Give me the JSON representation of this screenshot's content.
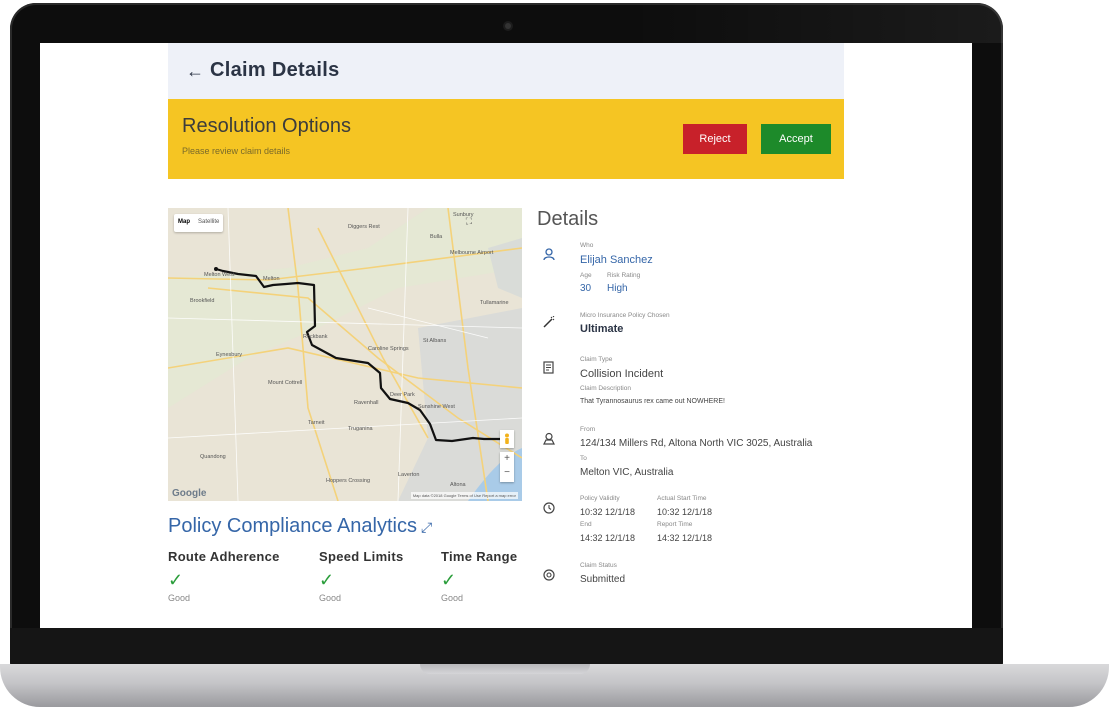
{
  "header": {
    "back_icon": "arrow-left-icon",
    "title": "Claim Details"
  },
  "banner": {
    "title": "Resolution Options",
    "subtitle": "Please review claim details",
    "reject_label": "Reject",
    "accept_label": "Accept",
    "colors": {
      "banner": "#f5c523",
      "reject": "#c8212a",
      "accept": "#1d8a2a"
    }
  },
  "map": {
    "toggle": [
      "Map",
      "Satellite"
    ],
    "places": [
      "Diggers Rest",
      "Bulla",
      "Sunbury",
      "Melbourne Airport",
      "Melton West",
      "Melton",
      "Brookfield",
      "Tullamarine",
      "Rockbank",
      "St Albans",
      "Caroline Springs",
      "Eynesbury",
      "Mount Cottrell",
      "Deer Park",
      "Ravenhall",
      "Sunshine West",
      "Tarneit",
      "Truganina",
      "Quandong",
      "Laverton",
      "Hoppers Crossing",
      "Altona"
    ],
    "logo": "Google",
    "attribution": "Map data ©2018 Google   Terms of Use   Report a map error"
  },
  "analytics": {
    "title": "Policy Compliance Analytics",
    "expand_icon": "expand-icon",
    "metrics": [
      {
        "label": "Route Adherence",
        "status": "Good"
      },
      {
        "label": "Speed Limits",
        "status": "Good"
      },
      {
        "label": "Time Range",
        "status": "Good"
      }
    ]
  },
  "details": {
    "title": "Details",
    "who": {
      "caption": "Who",
      "name": "Elijah Sanchez",
      "age_caption": "Age",
      "age": "30",
      "risk_caption": "Risk Rating",
      "risk": "High"
    },
    "policy": {
      "caption": "Micro Insurance Policy Chosen",
      "value": "Ultimate"
    },
    "claim": {
      "type_caption": "Claim Type",
      "type": "Collision Incident",
      "desc_caption": "Claim Description",
      "desc": "That Tyrannosaurus rex came out NOWHERE!"
    },
    "route": {
      "from_caption": "From",
      "from": "124/134 Millers Rd, Altona North VIC 3025, Australia",
      "to_caption": "To",
      "to": "Melton VIC, Australia"
    },
    "time": {
      "validity_caption": "Policy Validity",
      "validity_start": "10:32 12/1/18",
      "end_caption": "End",
      "end": "14:32 12/1/18",
      "actual_caption": "Actual Start Time",
      "actual": "10:32 12/1/18",
      "report_caption": "Report Time",
      "report": "14:32 12/1/18"
    },
    "status": {
      "caption": "Claim Status",
      "value": "Submitted"
    }
  }
}
